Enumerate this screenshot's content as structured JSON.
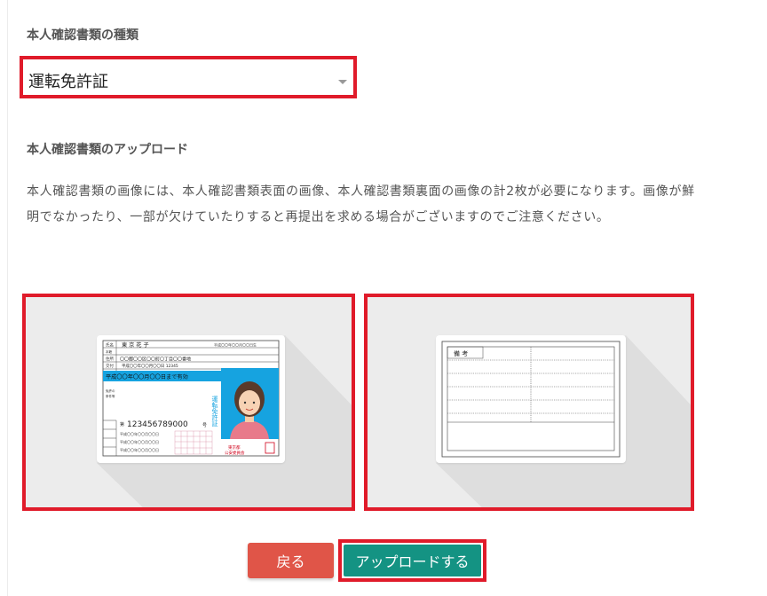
{
  "doc_type_section": {
    "title": "本人確認書類の種類",
    "selected_value": "運転免許証"
  },
  "upload_section": {
    "title": "本人確認書類のアップロード",
    "description": "本人確認書類の画像には、本人確認書類表面の画像、本人確認書類裏面の画像の計2枚が必要になります。画像が鮮明でなかったり、一部が欠けていたりすると再提出を求める場合がございますのでご注意ください。"
  },
  "license_front": {
    "name_label": "氏名",
    "name_value": "東 京 花 子",
    "birth": "平成〇〇年〇〇月〇〇日生",
    "address_label": "住所",
    "address_value": "〇〇都〇〇区〇〇町〇丁目〇〇番地",
    "issue_label": "交付",
    "issue_value": "平成〇〇年〇〇月〇〇日 12345",
    "expiry": "平成〇〇年〇〇月〇〇日まで有効",
    "number_label": "第",
    "number_value": "123456789000",
    "number_suffix": "号",
    "vertical_title": "運転免許証"
  },
  "license_back": {
    "remarks_label": "備 考"
  },
  "buttons": {
    "back_label": "戻る",
    "upload_label": "アップロードする"
  },
  "colors": {
    "highlight_border": "#e01b2a",
    "back_button": "#e05548",
    "upload_button": "#149383",
    "card_blue": "#16a3e0"
  }
}
